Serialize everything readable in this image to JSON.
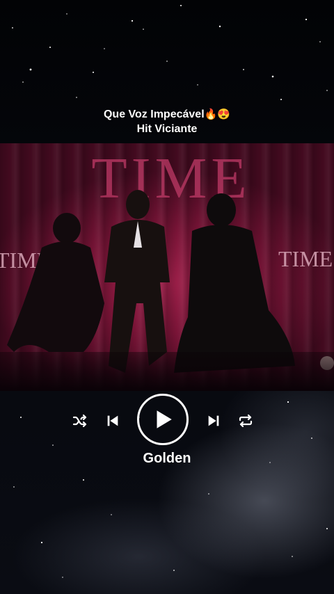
{
  "caption": {
    "line1": "Que Voz Impecável",
    "line1_emojis": "🔥😍",
    "line2": "Hit Viciante"
  },
  "video": {
    "backdrop_text": "TIME",
    "backdrop_text_left": "TIME",
    "backdrop_text_right": "TIME"
  },
  "player": {
    "song_title": "Golden",
    "controls": [
      "shuffle-icon",
      "previous-icon",
      "play-icon",
      "next-icon",
      "repeat-icon"
    ],
    "state": "paused"
  },
  "colors": {
    "stage_backdrop": "#8a1a40",
    "accent": "#ffffff",
    "sky": "#05070c"
  }
}
